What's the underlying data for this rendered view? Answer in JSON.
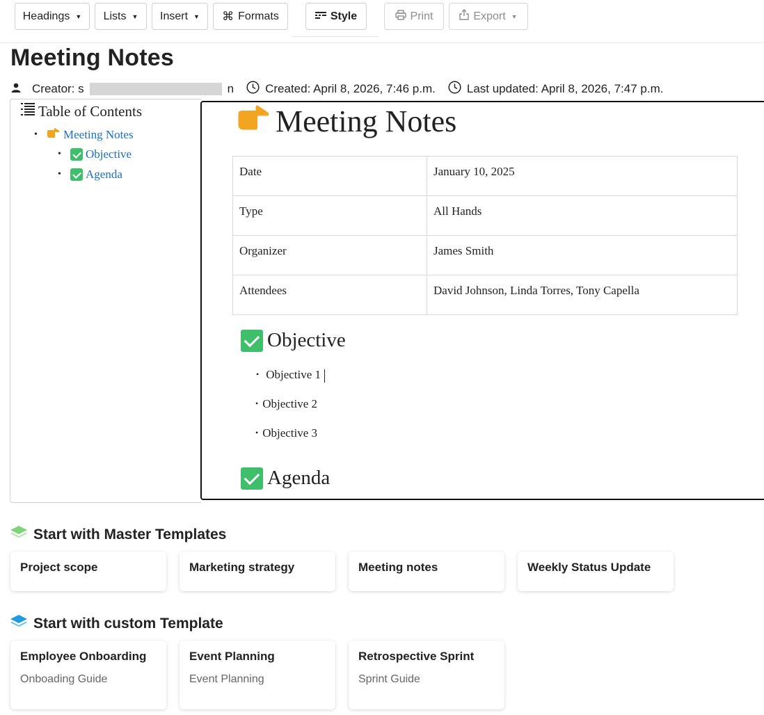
{
  "toolbar": {
    "headings": "Headings",
    "lists": "Lists",
    "insert": "Insert",
    "formats": "Formats",
    "style": "Style",
    "print": "Print",
    "export": "Export"
  },
  "page": {
    "title": "Meeting Notes",
    "creator_label": "Creator: s",
    "creator_suffix": "n",
    "created": "Created: April 8, 2026, 7:46 p.m.",
    "updated": "Last updated: April 8, 2026, 7:47 p.m."
  },
  "toc": {
    "heading": "Table of Contents",
    "items": [
      {
        "label": "Meeting Notes"
      },
      {
        "label": "Objective"
      },
      {
        "label": "Agenda"
      }
    ]
  },
  "doc": {
    "title": "Meeting Notes",
    "rows": [
      {
        "key": "Date",
        "value": "January 10, 2025"
      },
      {
        "key": "Type",
        "value": "All Hands"
      },
      {
        "key": "Organizer",
        "value": "James Smith"
      },
      {
        "key": "Attendees",
        "value": "David Johnson, Linda Torres, Tony Capella"
      }
    ],
    "objective_heading": "Objective",
    "objectives": [
      "Objective 1",
      "Objective 2",
      "Objective 3"
    ],
    "agenda_heading": "Agenda"
  },
  "master": {
    "heading": "Start with Master Templates",
    "cards": [
      "Project scope",
      "Marketing strategy",
      "Meeting notes",
      "Weekly Status Update"
    ]
  },
  "custom": {
    "heading": "Start with custom Template",
    "cards": [
      {
        "title": "Employee Onboarding",
        "sub": "Onboading Guide"
      },
      {
        "title": "Event Planning",
        "sub": "Event Planning"
      },
      {
        "title": "Retrospective Sprint",
        "sub": "Sprint Guide"
      }
    ]
  },
  "colors": {
    "link": "#1a6fc4",
    "check_green": "#3fbf6b",
    "master_icon": "#7fd47a",
    "custom_icon": "#1f9be0"
  }
}
